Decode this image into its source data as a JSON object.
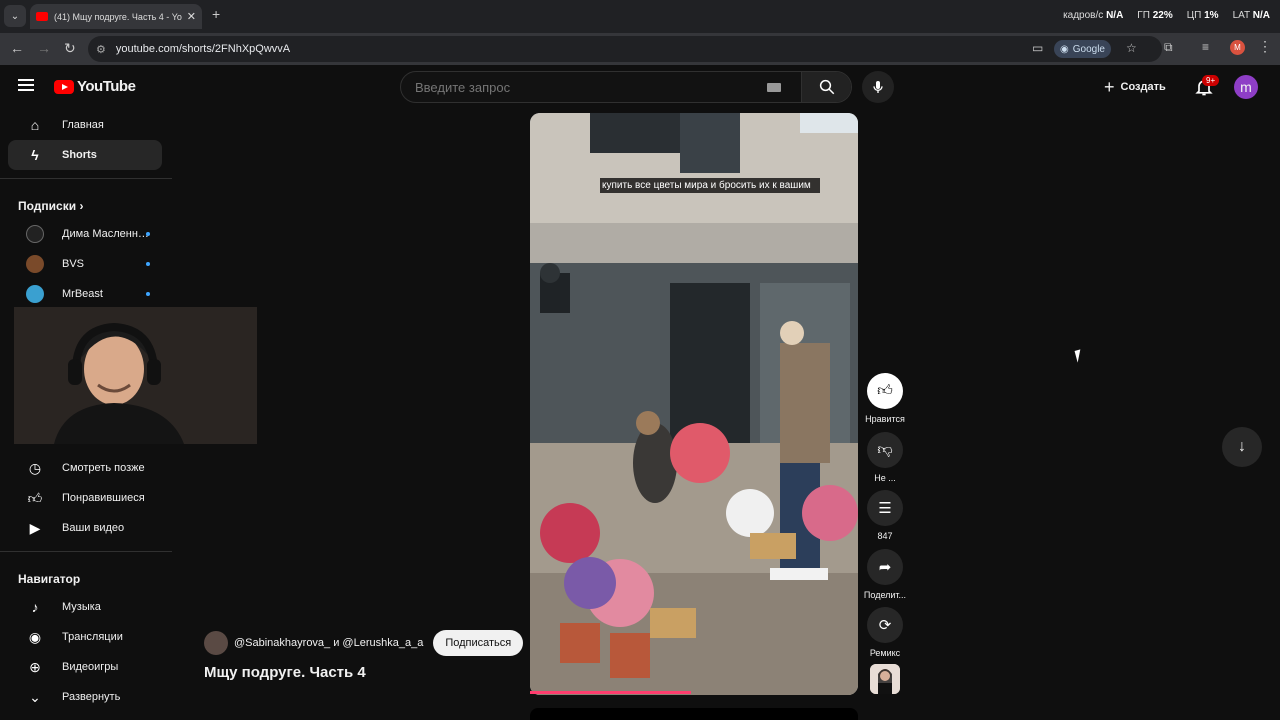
{
  "browser": {
    "tab_title": "(41) Мщу подруге. Часть 4 - Yo",
    "url": "youtube.com/shorts/2FNhXpQwvvA",
    "google_pill": "Google",
    "profile_letter": "M",
    "sys": {
      "fps_label": "кадров/с",
      "fps_value": "N/A",
      "gpu_label": "ГП",
      "gpu_value": "22",
      "gpu_unit": "%",
      "cpu_label": "ЦП",
      "cpu_value": "1",
      "cpu_unit": "%",
      "lat_label": "LAT",
      "lat_value": "N/A"
    }
  },
  "header": {
    "logo": "YouTube",
    "search_placeholder": "Введите запрос",
    "create_label": "Создать",
    "notif_badge": "9+",
    "avatar_letter": "m"
  },
  "sidebar": {
    "main": [
      {
        "label": "Главная",
        "icon": "home-icon"
      },
      {
        "label": "Shorts",
        "icon": "shorts-icon"
      }
    ],
    "subs_title": "Подписки",
    "subs": [
      {
        "label": "Дима Масленн…",
        "color": "#222222"
      },
      {
        "label": "BVS",
        "color": "#7a4a2a"
      },
      {
        "label": "MrBeast",
        "color": "#3aa0d0"
      }
    ],
    "you": [
      {
        "label": "Смотреть позже",
        "icon": "clock-icon"
      },
      {
        "label": "Понравившиеся",
        "icon": "thumb-up-icon"
      },
      {
        "label": "Ваши видео",
        "icon": "video-icon"
      }
    ],
    "nav_title": "Навигатор",
    "nav": [
      {
        "label": "Музыка",
        "icon": "music-icon"
      },
      {
        "label": "Трансляции",
        "icon": "live-icon"
      },
      {
        "label": "Видеоигры",
        "icon": "gamepad-icon"
      },
      {
        "label": "Развернуть",
        "icon": "chevron-down-icon"
      }
    ]
  },
  "short": {
    "caption": "купить все цветы мира и бросить их к вашим",
    "channels": "@Sabinakhayrova_ и @Lerushka_a_a",
    "subscribe": "Подписаться",
    "title": "Мщу подруге. Часть 4",
    "progress": 0.49
  },
  "actions": {
    "like": "Нравится",
    "dislike": "Не ...",
    "comments": "847",
    "share": "Поделит...",
    "remix": "Ремикс"
  }
}
